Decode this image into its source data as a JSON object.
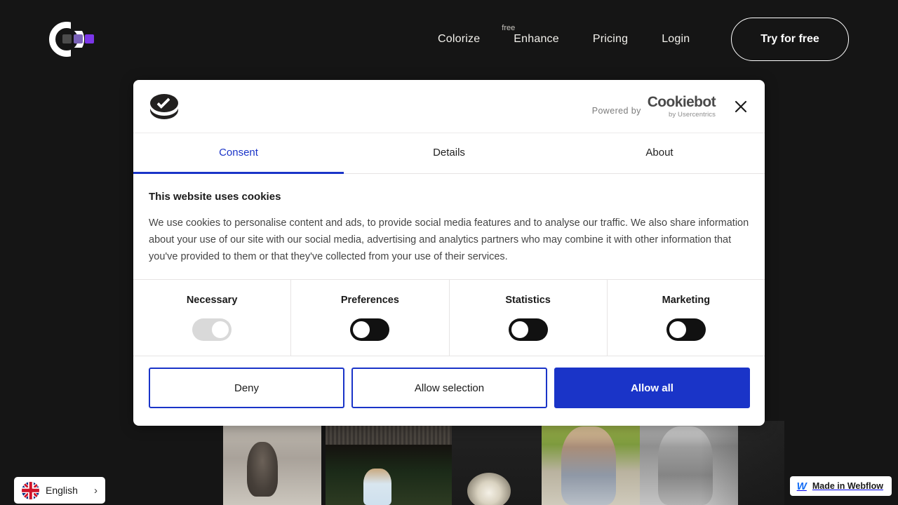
{
  "site": {
    "logo": {
      "name": "colorize-logo",
      "square_colors": [
        "#4c4c4c",
        "#7a62b8",
        "#7b36e8"
      ],
      "c_color": "#ffffff"
    },
    "nav": [
      {
        "label": "Colorize",
        "superscript": ""
      },
      {
        "label": "Enhance",
        "superscript": "free"
      },
      {
        "label": "Pricing",
        "superscript": ""
      },
      {
        "label": "Login",
        "superscript": ""
      }
    ],
    "cta_label": "Try for free",
    "background_color": "#151515"
  },
  "cookie_dialog": {
    "brand_icon": "cookie-check-icon",
    "powered_by_label": "Powered by",
    "powered_by_brand": "Cookiebot",
    "powered_by_sub": "by Usercentrics",
    "close_label": "×",
    "tabs": [
      {
        "label": "Consent",
        "active": true
      },
      {
        "label": "Details",
        "active": false
      },
      {
        "label": "About",
        "active": false
      }
    ],
    "title": "This website uses cookies",
    "body": "We use cookies to personalise content and ads, to provide social media features and to analyse our traffic. We also share information about your use of our site with our social media, advertising and analytics partners who may combine it with other information that you've provided to them or that they've collected from your use of their services.",
    "categories": [
      {
        "label": "Necessary",
        "state": "locked-on"
      },
      {
        "label": "Preferences",
        "state": "off"
      },
      {
        "label": "Statistics",
        "state": "off"
      },
      {
        "label": "Marketing",
        "state": "off"
      }
    ],
    "actions": [
      {
        "label": "Deny",
        "style": "outline"
      },
      {
        "label": "Allow selection",
        "style": "outline"
      },
      {
        "label": "Allow all",
        "style": "filled"
      }
    ],
    "accent_color": "#1a34c8"
  },
  "language_widget": {
    "flag": "uk-flag-icon",
    "label": "English",
    "chevron": "›"
  },
  "webflow_badge": {
    "logo": "webflow-logo-icon",
    "label": "Made in Webflow"
  }
}
